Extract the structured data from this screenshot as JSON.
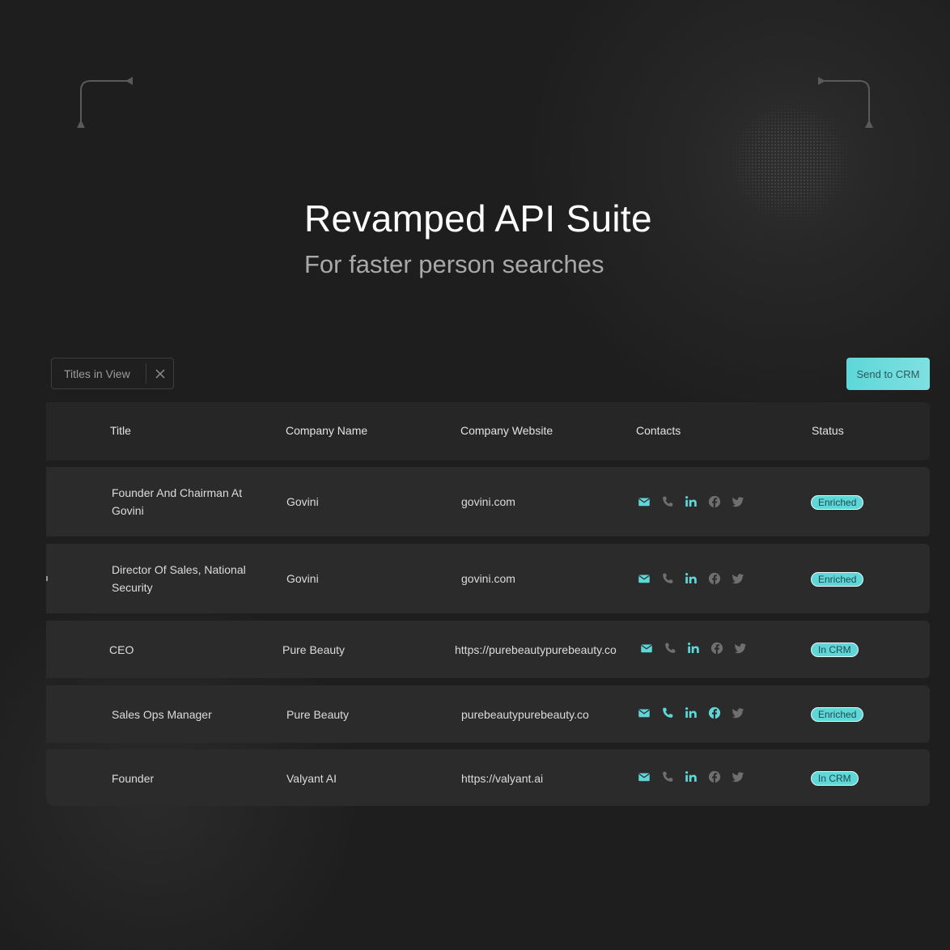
{
  "hero": {
    "title": "Revamped API Suite",
    "subtitle": "For faster person searches"
  },
  "toolbar": {
    "filter_chip_label": "Titles in View",
    "send_button_label": "Send to CRM"
  },
  "table": {
    "columns": [
      "Title",
      "Company Name",
      "Company Website",
      "Contacts",
      "Status"
    ],
    "rows": [
      {
        "title": "Founder And Chairman At Govini",
        "company": "Govini",
        "website": "govini.com",
        "status": "Enriched",
        "phone_active": false,
        "facebook_active": false
      },
      {
        "title": "Director Of Sales, National Security",
        "company": "Govini",
        "website": "govini.com",
        "status": "Enriched",
        "phone_active": false,
        "facebook_active": false
      },
      {
        "title": "CEO",
        "company": "Pure Beauty",
        "website": "https://purebeautypurebeauty.co",
        "status": "In CRM",
        "phone_active": false,
        "facebook_active": false
      },
      {
        "title": "Sales Ops Manager",
        "company": "Pure Beauty",
        "website": "purebeautypurebeauty.co",
        "status": "Enriched",
        "phone_active": true,
        "facebook_active": true
      },
      {
        "title": "Founder",
        "company": "Valyant AI",
        "website": "https://valyant.ai",
        "status": "In CRM",
        "phone_active": false,
        "facebook_active": false
      }
    ],
    "contact_icons": [
      "mail-icon",
      "phone-icon",
      "linkedin-icon",
      "facebook-icon",
      "twitter-icon"
    ]
  },
  "colors": {
    "accent": "#5fd6d8",
    "inactive_icon": "#6f6f6f",
    "background": "#1e1e1e"
  }
}
